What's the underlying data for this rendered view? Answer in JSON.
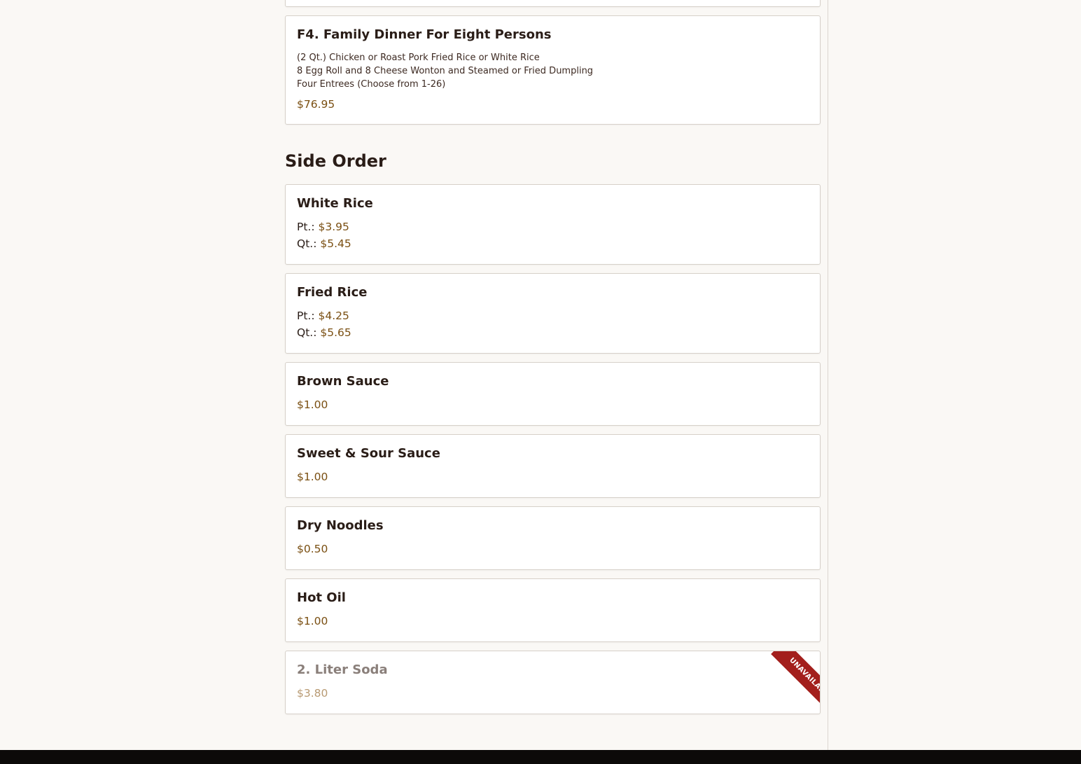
{
  "family_dinner": {
    "title": "F4. Family Dinner For Eight Persons",
    "desc_lines": [
      "(2 Qt.) Chicken or Roast Pork Fried Rice or White Rice",
      "8 Egg Roll and 8 Cheese Wonton and Steamed or Fried Dumpling",
      "Four Entrees (Choose from 1-26)"
    ],
    "price": "$76.95"
  },
  "side_order": {
    "heading": "Side Order",
    "items": [
      {
        "title": "White Rice",
        "prices": [
          {
            "label": "Pt.:",
            "price": "$3.95"
          },
          {
            "label": "Qt.:",
            "price": "$5.45"
          }
        ]
      },
      {
        "title": "Fried Rice",
        "prices": [
          {
            "label": "Pt.:",
            "price": "$4.25"
          },
          {
            "label": "Qt.:",
            "price": "$5.65"
          }
        ]
      },
      {
        "title": "Brown Sauce",
        "price": "$1.00"
      },
      {
        "title": "Sweet & Sour Sauce",
        "price": "$1.00"
      },
      {
        "title": "Dry Noodles",
        "price": "$0.50"
      },
      {
        "title": "Hot Oil",
        "price": "$1.00"
      },
      {
        "title": "2. Liter Soda",
        "price": "$3.80",
        "badge": "UNAVAILABLE"
      }
    ]
  },
  "colors": {
    "price": "#7a4f12",
    "ribbon": "#a31f1c",
    "footer": "#0c0a09"
  }
}
